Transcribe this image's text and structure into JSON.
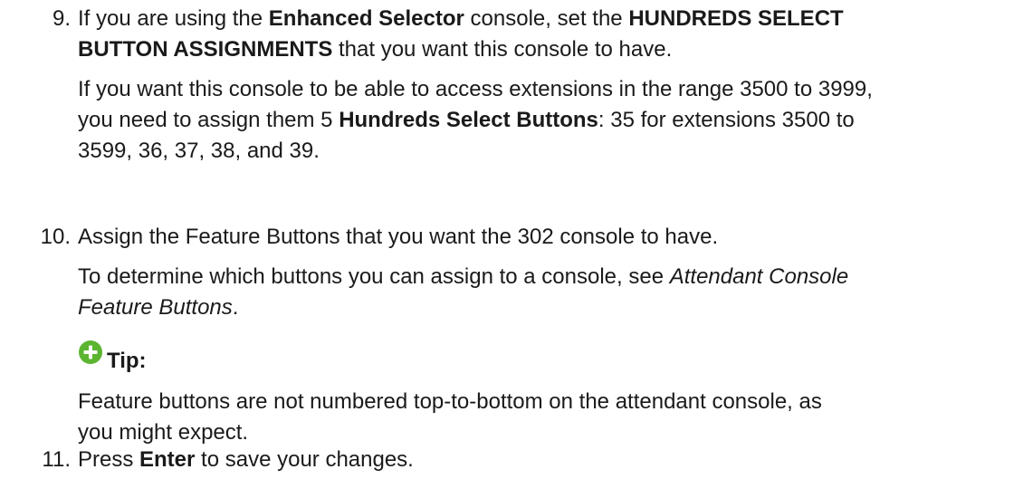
{
  "steps": [
    {
      "number": "9.",
      "p1": {
        "t1": "If you are using the ",
        "b1": "Enhanced Selector",
        "t2": " console, set the ",
        "b2": "HUNDREDS SELECT",
        "b3": "BUTTON ASSIGNMENTS",
        "t3": " that you want this console to have."
      },
      "p2": {
        "t1": "If you want this console to be able to access extensions in the range 3500 to 3999,",
        "t2": "you need to assign them 5 ",
        "b1": "Hundreds Select Buttons",
        "t3": ": 35 for extensions 3500 to",
        "t4": "3599, 36, 37, 38, and 39."
      }
    },
    {
      "number": "10.",
      "p1": {
        "t1": "Assign the Feature Buttons that you want the 302 console to have."
      },
      "p2": {
        "t1": "To determine which buttons you can assign to a console, see ",
        "i1": "Attendant Console",
        "i2": "Feature Buttons",
        "t2": "."
      },
      "tip": {
        "icon": "plus-circle-icon",
        "icon_color": "#5cb531",
        "label": "Tip:",
        "line1": "Feature buttons are not numbered top-to-bottom on the attendant console, as",
        "line2": "you might expect."
      }
    },
    {
      "number": "11.",
      "p1": {
        "t1": "Press ",
        "b1": "Enter",
        "t2": " to save your changes."
      }
    }
  ]
}
